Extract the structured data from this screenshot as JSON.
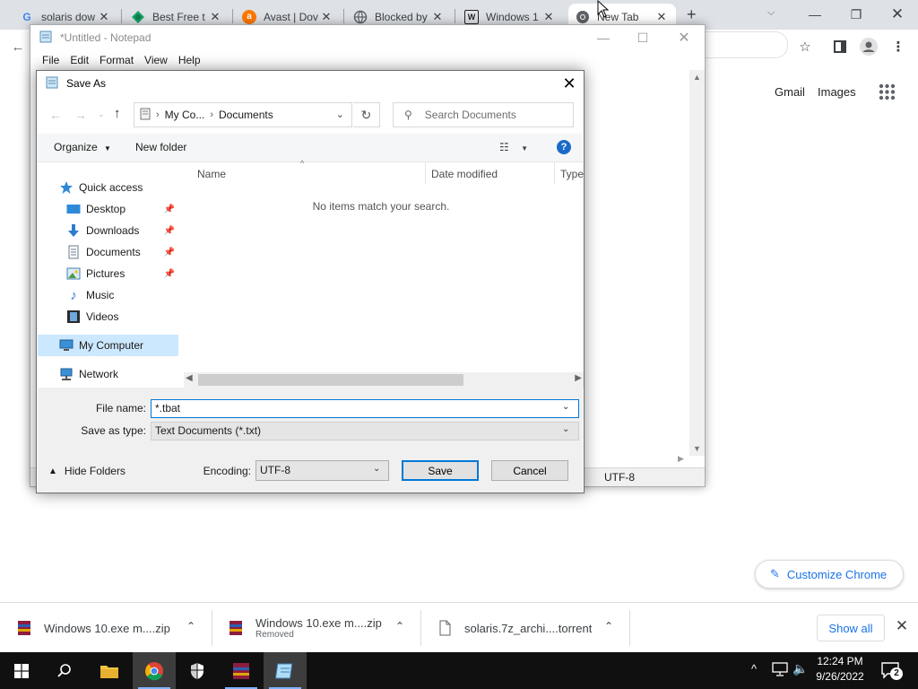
{
  "browser": {
    "tabs": [
      {
        "title": "solaris dow",
        "icon": "google-icon"
      },
      {
        "title": "Best Free t",
        "icon": "green-diamond-icon"
      },
      {
        "title": "Avast | Dov",
        "icon": "avast-icon"
      },
      {
        "title": "Blocked by",
        "icon": "globe-icon"
      },
      {
        "title": "Windows 1",
        "icon": "wikipedia-icon"
      },
      {
        "title": "New Tab",
        "icon": "chrome-icon"
      }
    ],
    "new_tab_glyph": "+",
    "links": {
      "gmail": "Gmail",
      "images": "Images"
    },
    "customize_label": "Customize Chrome",
    "accent": "#1a73e8"
  },
  "downloads": {
    "items": [
      {
        "name": "Windows 10.exe m....zip",
        "status": ""
      },
      {
        "name": "Windows 10.exe m....zip",
        "status": "Removed"
      },
      {
        "name": "solaris.7z_archi....torrent",
        "status": ""
      }
    ],
    "show_all": "Show all"
  },
  "taskbar": {
    "time": "12:24 PM",
    "date": "9/26/2022",
    "notification_count": "2"
  },
  "notepad": {
    "title": "*Untitled - Notepad",
    "menu": [
      "File",
      "Edit",
      "Format",
      "View",
      "Help"
    ],
    "status_encoding": "UTF-8"
  },
  "save_dialog": {
    "title": "Save As",
    "breadcrumb": [
      "My Co...",
      "Documents"
    ],
    "search_placeholder": "Search Documents",
    "organize": "Organize",
    "new_folder": "New folder",
    "help": "?",
    "nav": {
      "quick_access": "Quick access",
      "pinned": [
        "Desktop",
        "Downloads",
        "Documents",
        "Pictures"
      ],
      "unpinned": [
        "Music",
        "Videos"
      ],
      "my_computer": "My Computer",
      "network": "Network"
    },
    "columns": [
      "Name",
      "Date modified",
      "Type"
    ],
    "empty_message": "No items match your search.",
    "file_name_label": "File name:",
    "file_name_value": "*.tbat",
    "save_type_label": "Save as type:",
    "save_type_value": "Text Documents (*.txt)",
    "hide_folders": "Hide Folders",
    "encoding_label": "Encoding:",
    "encoding_value": "UTF-8",
    "save_button": "Save",
    "cancel_button": "Cancel"
  }
}
